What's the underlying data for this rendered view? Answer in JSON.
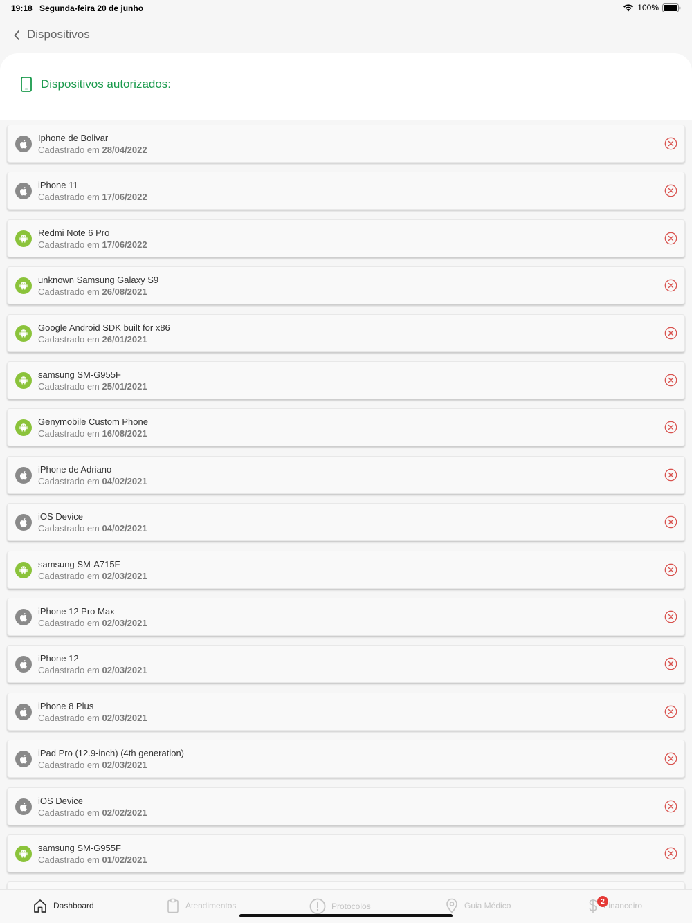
{
  "status_bar": {
    "time": "19:18",
    "date": "Segunda-feira 20 de junho",
    "battery": "100%"
  },
  "nav": {
    "title": "Dispositivos"
  },
  "panel": {
    "title": "Dispositivos autorizados:"
  },
  "colors": {
    "accent_green": "#1a9a4c",
    "android_green": "#8bc33b",
    "apple_gray": "#8a8a8a",
    "remove_red": "#d9534f",
    "badge_red": "#e53935"
  },
  "devices": [
    {
      "name": "Iphone de Bolivar",
      "prefix": "Cadastrado em",
      "date": "28/04/2022",
      "os": "apple-icon"
    },
    {
      "name": "iPhone 11",
      "prefix": "Cadastrado em",
      "date": "17/06/2022",
      "os": "apple-icon"
    },
    {
      "name": "Redmi Note 6 Pro",
      "prefix": "Cadastrado em",
      "date": "17/06/2022",
      "os": "android-icon"
    },
    {
      "name": "unknown Samsung Galaxy S9",
      "prefix": "Cadastrado em",
      "date": "26/08/2021",
      "os": "android-icon"
    },
    {
      "name": "Google Android SDK built for x86",
      "prefix": "Cadastrado em",
      "date": "26/01/2021",
      "os": "android-icon"
    },
    {
      "name": "samsung SM-G955F",
      "prefix": "Cadastrado em",
      "date": "25/01/2021",
      "os": "android-icon"
    },
    {
      "name": "Genymobile Custom Phone",
      "prefix": "Cadastrado em",
      "date": "16/08/2021",
      "os": "android-icon"
    },
    {
      "name": "iPhone de Adriano",
      "prefix": "Cadastrado em",
      "date": "04/02/2021",
      "os": "apple-icon"
    },
    {
      "name": "iOS Device",
      "prefix": "Cadastrado em",
      "date": "04/02/2021",
      "os": "apple-icon"
    },
    {
      "name": "samsung SM-A715F",
      "prefix": "Cadastrado em",
      "date": "02/03/2021",
      "os": "android-icon"
    },
    {
      "name": "iPhone 12 Pro Max",
      "prefix": "Cadastrado em",
      "date": "02/03/2021",
      "os": "apple-icon"
    },
    {
      "name": "iPhone 12",
      "prefix": "Cadastrado em",
      "date": "02/03/2021",
      "os": "apple-icon"
    },
    {
      "name": "iPhone 8 Plus",
      "prefix": "Cadastrado em",
      "date": "02/03/2021",
      "os": "apple-icon"
    },
    {
      "name": "iPad Pro (12.9-inch) (4th generation)",
      "prefix": "Cadastrado em",
      "date": "02/03/2021",
      "os": "apple-icon"
    },
    {
      "name": "iOS Device",
      "prefix": "Cadastrado em",
      "date": "02/02/2021",
      "os": "apple-icon"
    },
    {
      "name": "samsung SM-G955F",
      "prefix": "Cadastrado em",
      "date": "01/02/2021",
      "os": "android-icon"
    }
  ],
  "tabbar": {
    "tabs": [
      {
        "label": "Dashboard",
        "icon": "home-icon",
        "active": true
      },
      {
        "label": "Atendimentos",
        "icon": "clipboard-icon",
        "active": false
      },
      {
        "label": "Protocolos",
        "icon": "alert-circle-icon",
        "active": false
      },
      {
        "label": "Guia Médico",
        "icon": "map-pin-icon",
        "active": false
      },
      {
        "label": "Financeiro",
        "icon": "dollar-icon",
        "active": false,
        "badge": "2"
      }
    ]
  }
}
